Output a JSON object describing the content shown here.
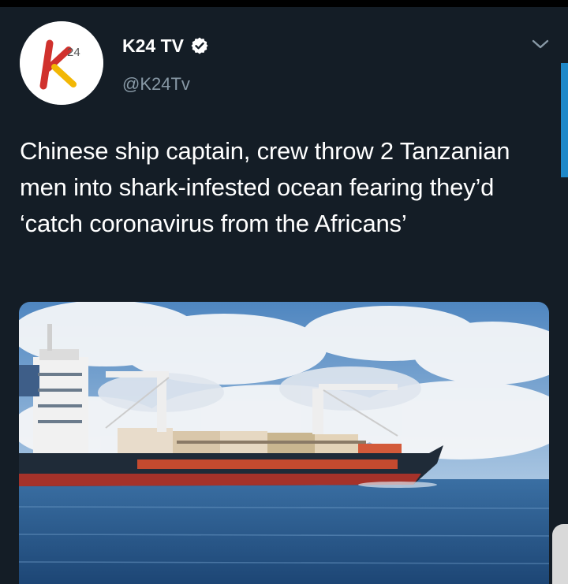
{
  "tweet": {
    "display_name": "K24 TV",
    "handle": "@K24Tv",
    "text": "Chinese ship captain, crew throw 2 Tanzanian men into shark-infested ocean fearing they’d ‘catch coronavirus from the Africans’",
    "avatar_logo_text": "K24",
    "verified_icon": "verified-badge-icon",
    "menu_icon": "chevron-down-icon",
    "media_description_icon": "photo"
  },
  "colors": {
    "background": "#141d26",
    "text_primary": "#ffffff",
    "text_secondary": "#8899a6",
    "accent": "#1e88c9",
    "logo_red": "#d0312d",
    "logo_yellow": "#f2b705"
  }
}
